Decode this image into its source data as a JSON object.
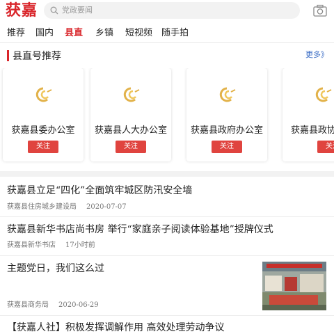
{
  "header": {
    "logo_text": "获嘉",
    "search_placeholder": "党政要闻",
    "accent_color": "#d9252a"
  },
  "nav": {
    "tabs": [
      {
        "label": "推荐",
        "active": false
      },
      {
        "label": "国内",
        "active": false
      },
      {
        "label": "县直",
        "active": true
      },
      {
        "label": "乡镇",
        "active": false
      },
      {
        "label": "短视频",
        "active": false
      },
      {
        "label": "随手拍",
        "active": false
      }
    ]
  },
  "section": {
    "title": "县直号推荐",
    "more_label": "更多》"
  },
  "cards": [
    {
      "name": "获嘉县委办公室",
      "follow_label": "关注"
    },
    {
      "name": "获嘉县人大办公室",
      "follow_label": "关注"
    },
    {
      "name": "获嘉县政府办公室",
      "follow_label": "关注"
    },
    {
      "name": "获嘉县政协",
      "follow_label": "关注"
    }
  ],
  "news": [
    {
      "title": "获嘉县立足“四化”全面筑牢城区防汛安全墙",
      "source": "获嘉县住房城乡建设局",
      "time": "2020-07-07"
    },
    {
      "title": "获嘉县新华书店尚书房 举行“家庭亲子阅读体验基地”授牌仪式",
      "source": "获嘉县新华书店",
      "time": "17小时前"
    },
    {
      "title": "主题党日，我们这么过",
      "source": "获嘉县商务局",
      "time": "2020-06-29",
      "thumbnail": "party-day-photo"
    },
    {
      "title": "【获嘉人社】积极发挥调解作用 高效处理劳动争议",
      "source": "",
      "time": ""
    }
  ]
}
